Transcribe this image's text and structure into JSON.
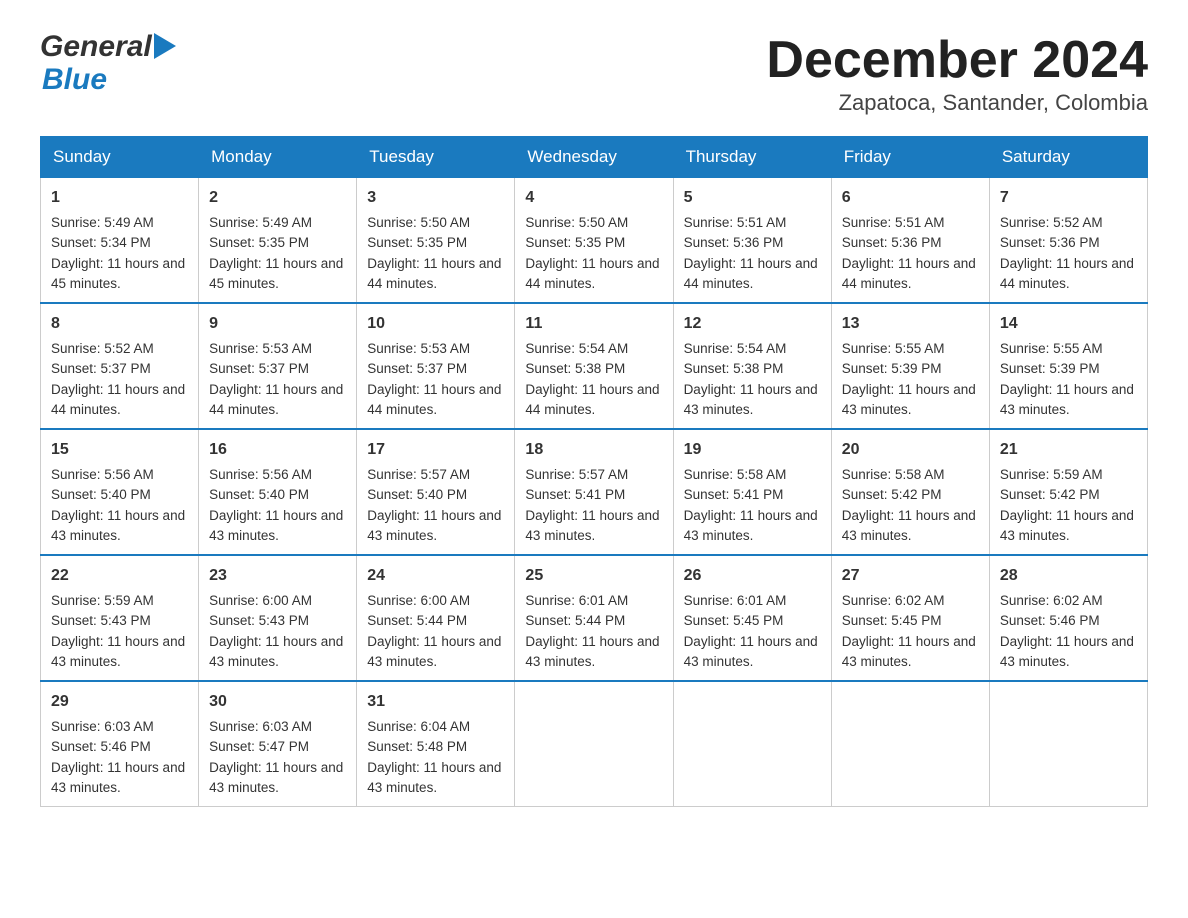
{
  "header": {
    "logo_general": "General",
    "logo_blue": "Blue",
    "month_title": "December 2024",
    "location": "Zapatoca, Santander, Colombia"
  },
  "days_of_week": [
    "Sunday",
    "Monday",
    "Tuesday",
    "Wednesday",
    "Thursday",
    "Friday",
    "Saturday"
  ],
  "weeks": [
    [
      {
        "day": "1",
        "sunrise": "5:49 AM",
        "sunset": "5:34 PM",
        "daylight": "11 hours and 45 minutes."
      },
      {
        "day": "2",
        "sunrise": "5:49 AM",
        "sunset": "5:35 PM",
        "daylight": "11 hours and 45 minutes."
      },
      {
        "day": "3",
        "sunrise": "5:50 AM",
        "sunset": "5:35 PM",
        "daylight": "11 hours and 44 minutes."
      },
      {
        "day": "4",
        "sunrise": "5:50 AM",
        "sunset": "5:35 PM",
        "daylight": "11 hours and 44 minutes."
      },
      {
        "day": "5",
        "sunrise": "5:51 AM",
        "sunset": "5:36 PM",
        "daylight": "11 hours and 44 minutes."
      },
      {
        "day": "6",
        "sunrise": "5:51 AM",
        "sunset": "5:36 PM",
        "daylight": "11 hours and 44 minutes."
      },
      {
        "day": "7",
        "sunrise": "5:52 AM",
        "sunset": "5:36 PM",
        "daylight": "11 hours and 44 minutes."
      }
    ],
    [
      {
        "day": "8",
        "sunrise": "5:52 AM",
        "sunset": "5:37 PM",
        "daylight": "11 hours and 44 minutes."
      },
      {
        "day": "9",
        "sunrise": "5:53 AM",
        "sunset": "5:37 PM",
        "daylight": "11 hours and 44 minutes."
      },
      {
        "day": "10",
        "sunrise": "5:53 AM",
        "sunset": "5:37 PM",
        "daylight": "11 hours and 44 minutes."
      },
      {
        "day": "11",
        "sunrise": "5:54 AM",
        "sunset": "5:38 PM",
        "daylight": "11 hours and 44 minutes."
      },
      {
        "day": "12",
        "sunrise": "5:54 AM",
        "sunset": "5:38 PM",
        "daylight": "11 hours and 43 minutes."
      },
      {
        "day": "13",
        "sunrise": "5:55 AM",
        "sunset": "5:39 PM",
        "daylight": "11 hours and 43 minutes."
      },
      {
        "day": "14",
        "sunrise": "5:55 AM",
        "sunset": "5:39 PM",
        "daylight": "11 hours and 43 minutes."
      }
    ],
    [
      {
        "day": "15",
        "sunrise": "5:56 AM",
        "sunset": "5:40 PM",
        "daylight": "11 hours and 43 minutes."
      },
      {
        "day": "16",
        "sunrise": "5:56 AM",
        "sunset": "5:40 PM",
        "daylight": "11 hours and 43 minutes."
      },
      {
        "day": "17",
        "sunrise": "5:57 AM",
        "sunset": "5:40 PM",
        "daylight": "11 hours and 43 minutes."
      },
      {
        "day": "18",
        "sunrise": "5:57 AM",
        "sunset": "5:41 PM",
        "daylight": "11 hours and 43 minutes."
      },
      {
        "day": "19",
        "sunrise": "5:58 AM",
        "sunset": "5:41 PM",
        "daylight": "11 hours and 43 minutes."
      },
      {
        "day": "20",
        "sunrise": "5:58 AM",
        "sunset": "5:42 PM",
        "daylight": "11 hours and 43 minutes."
      },
      {
        "day": "21",
        "sunrise": "5:59 AM",
        "sunset": "5:42 PM",
        "daylight": "11 hours and 43 minutes."
      }
    ],
    [
      {
        "day": "22",
        "sunrise": "5:59 AM",
        "sunset": "5:43 PM",
        "daylight": "11 hours and 43 minutes."
      },
      {
        "day": "23",
        "sunrise": "6:00 AM",
        "sunset": "5:43 PM",
        "daylight": "11 hours and 43 minutes."
      },
      {
        "day": "24",
        "sunrise": "6:00 AM",
        "sunset": "5:44 PM",
        "daylight": "11 hours and 43 minutes."
      },
      {
        "day": "25",
        "sunrise": "6:01 AM",
        "sunset": "5:44 PM",
        "daylight": "11 hours and 43 minutes."
      },
      {
        "day": "26",
        "sunrise": "6:01 AM",
        "sunset": "5:45 PM",
        "daylight": "11 hours and 43 minutes."
      },
      {
        "day": "27",
        "sunrise": "6:02 AM",
        "sunset": "5:45 PM",
        "daylight": "11 hours and 43 minutes."
      },
      {
        "day": "28",
        "sunrise": "6:02 AM",
        "sunset": "5:46 PM",
        "daylight": "11 hours and 43 minutes."
      }
    ],
    [
      {
        "day": "29",
        "sunrise": "6:03 AM",
        "sunset": "5:46 PM",
        "daylight": "11 hours and 43 minutes."
      },
      {
        "day": "30",
        "sunrise": "6:03 AM",
        "sunset": "5:47 PM",
        "daylight": "11 hours and 43 minutes."
      },
      {
        "day": "31",
        "sunrise": "6:04 AM",
        "sunset": "5:48 PM",
        "daylight": "11 hours and 43 minutes."
      },
      null,
      null,
      null,
      null
    ]
  ],
  "labels": {
    "sunrise": "Sunrise:",
    "sunset": "Sunset:",
    "daylight": "Daylight:"
  }
}
